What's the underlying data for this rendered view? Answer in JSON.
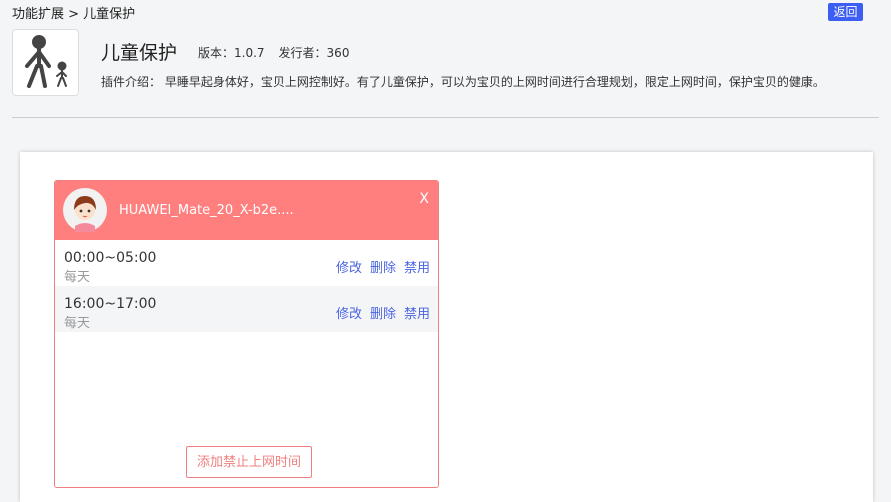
{
  "breadcrumb": "功能扩展 > 儿童保护",
  "back_label": "返回",
  "plugin": {
    "title": "儿童保护",
    "version": "版本：1.0.7",
    "publisher": "发行者：360",
    "description": "插件介绍： 早睡早起身体好，宝贝上网控制好。有了儿童保护，可以为宝贝的上网时间进行合理规划，限定上网时间，保护宝贝的健康。"
  },
  "device": {
    "name": "HUAWEI_Mate_20_X-b2e....",
    "close": "X",
    "rules": [
      {
        "time": "00:00~05:00",
        "repeat": "每天"
      },
      {
        "time": "16:00~17:00",
        "repeat": "每天"
      }
    ],
    "actions": {
      "edit": "修改",
      "delete": "删除",
      "disable": "禁用"
    },
    "add_label": "添加禁止上网时间"
  }
}
